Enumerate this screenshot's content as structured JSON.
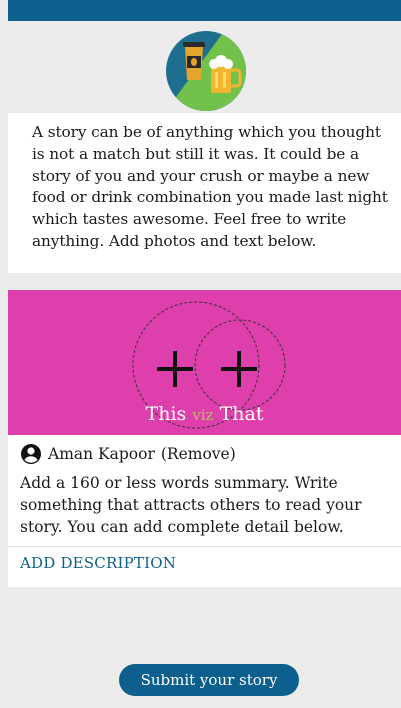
{
  "intro": {
    "text": "A story can be of anything which you thought is not a match but still it was. It could be a story of you and your crush or maybe a new food or drink combination you made last night which tastes awesome. Feel free to write anything. Add photos and text below."
  },
  "hero": {
    "caption_left": "This",
    "caption_mid": "viz",
    "caption_right": "That",
    "bg_color": "#df3fad"
  },
  "author": {
    "name": "Aman Kapoor",
    "action": "(Remove)"
  },
  "summary": {
    "text": "Add a 160 or less words summary. Write something that attracts others to read your story. You can add complete detail below."
  },
  "description": {
    "label": "ADD DESCRIPTION"
  },
  "submit": {
    "label": "Submit your story"
  },
  "colors": {
    "accent": "#0d5f8d"
  },
  "icons": {
    "logo": "coffee-beer-logo-icon",
    "add": "plus-icon",
    "user": "user-avatar-icon"
  }
}
